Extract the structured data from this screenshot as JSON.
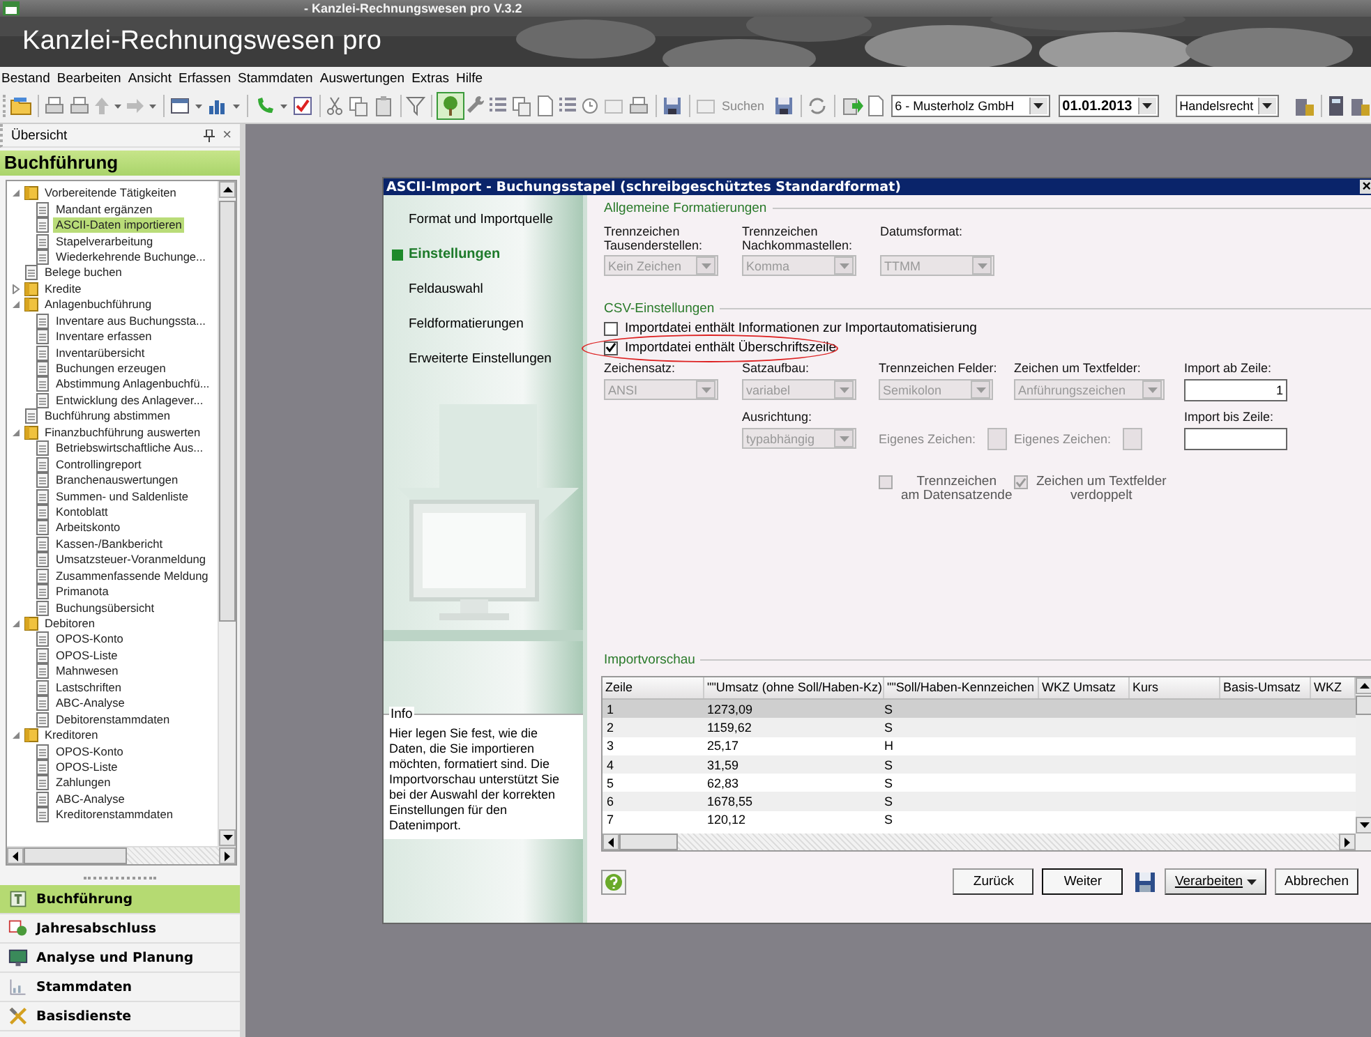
{
  "window": {
    "title": "- Kanzlei-Rechnungswesen pro V.3.2"
  },
  "banner": {
    "title": "Kanzlei-Rechnungswesen pro"
  },
  "menu": [
    "Bestand",
    "Bearbeiten",
    "Ansicht",
    "Erfassen",
    "Stammdaten",
    "Auswertungen",
    "Extras",
    "Hilfe"
  ],
  "toolbar": {
    "search_label": "Suchen",
    "company": "6 - Musterholz GmbH",
    "date": "01.01.2013",
    "law": "Handelsrecht"
  },
  "sidebar": {
    "title": "Übersicht",
    "close": "×",
    "section": "Buchführung",
    "tree": [
      {
        "label": "Vorbereitende Tätigkeiten",
        "kind": "folder",
        "expanded": true,
        "selected": false,
        "children": [
          {
            "label": "Mandant ergänzen",
            "selected": false
          },
          {
            "label": "ASCII-Daten importieren",
            "selected": true
          },
          {
            "label": "Stapelverarbeitung",
            "selected": false
          },
          {
            "label": "Wiederkehrende Buchunge...",
            "selected": false
          }
        ]
      },
      {
        "label": "Belege buchen",
        "kind": "page",
        "selected": false
      },
      {
        "label": "Kredite",
        "kind": "folder",
        "expanded": false,
        "selected": false
      },
      {
        "label": "Anlagenbuchführung",
        "kind": "folder",
        "expanded": true,
        "selected": false,
        "children": [
          {
            "label": "Inventare aus Buchungssta...",
            "selected": false
          },
          {
            "label": "Inventare erfassen",
            "selected": false
          },
          {
            "label": "Inventarübersicht",
            "selected": false
          },
          {
            "label": "Buchungen erzeugen",
            "selected": false
          },
          {
            "label": "Abstimmung Anlagenbuchfü...",
            "selected": false
          },
          {
            "label": "Entwicklung des Anlagever...",
            "selected": false
          }
        ]
      },
      {
        "label": "Buchführung abstimmen",
        "kind": "page",
        "selected": false
      },
      {
        "label": "Finanzbuchführung auswerten",
        "kind": "folder",
        "expanded": true,
        "selected": false,
        "children": [
          {
            "label": "Betriebswirtschaftliche Aus...",
            "selected": false
          },
          {
            "label": "Controllingreport",
            "selected": false
          },
          {
            "label": "Branchenauswertungen",
            "selected": false
          },
          {
            "label": "Summen- und Saldenliste",
            "selected": false
          },
          {
            "label": "Kontoblatt",
            "selected": false
          },
          {
            "label": "Arbeitskonto",
            "selected": false
          },
          {
            "label": "Kassen-/Bankbericht",
            "selected": false
          },
          {
            "label": "Umsatzsteuer-Voranmeldung",
            "selected": false
          },
          {
            "label": "Zusammenfassende Meldung",
            "selected": false
          },
          {
            "label": "Primanota",
            "selected": false
          },
          {
            "label": "Buchungsübersicht",
            "selected": false
          }
        ]
      },
      {
        "label": "Debitoren",
        "kind": "folder",
        "expanded": true,
        "selected": false,
        "children": [
          {
            "label": "OPOS-Konto",
            "selected": false
          },
          {
            "label": "OPOS-Liste",
            "selected": false
          },
          {
            "label": "Mahnwesen",
            "selected": false
          },
          {
            "label": "Lastschriften",
            "selected": false
          },
          {
            "label": "ABC-Analyse",
            "selected": false
          },
          {
            "label": "Debitorenstammdaten",
            "selected": false
          }
        ]
      },
      {
        "label": "Kreditoren",
        "kind": "folder",
        "expanded": true,
        "selected": false,
        "children": [
          {
            "label": "OPOS-Konto",
            "selected": false
          },
          {
            "label": "OPOS-Liste",
            "selected": false
          },
          {
            "label": "Zahlungen",
            "selected": false
          },
          {
            "label": "ABC-Analyse",
            "selected": false
          },
          {
            "label": "Kreditorenstammdaten",
            "selected": false
          }
        ]
      }
    ],
    "nav": [
      {
        "label": "Buchführung",
        "kind": "ledger",
        "selected": true
      },
      {
        "label": "Jahresabschluss",
        "kind": "report",
        "selected": false
      },
      {
        "label": "Analyse und Planung",
        "kind": "monitor",
        "selected": false
      },
      {
        "label": "Stammdaten",
        "kind": "chart",
        "selected": false
      },
      {
        "label": "Basisdienste",
        "kind": "tools",
        "selected": false
      }
    ]
  },
  "dialog": {
    "title": "ASCII-Import - Buchungsstapel (schreibgeschütztes Standardformat)",
    "close": "×",
    "steps": [
      {
        "label": "Format und Importquelle",
        "selected": false
      },
      {
        "label": "Einstellungen",
        "selected": true
      },
      {
        "label": "Feldauswahl",
        "selected": false
      },
      {
        "label": "Feldformatierungen",
        "selected": false
      },
      {
        "label": "Erweiterte Einstellungen",
        "selected": false
      }
    ],
    "info": {
      "title": "Info",
      "text": "Hier legen Sie fest, wie die Daten, die Sie importieren möchten, formatiert sind. Die Importvorschau unterstützt Sie bei der Auswahl der korrekten Einstellungen für den Datenimport."
    },
    "general": {
      "title": "Allgemeine Formatierungen",
      "fields": [
        {
          "label": "Trennzeichen\nTausenderstellen:",
          "value": "Kein Zeichen",
          "disabled": true
        },
        {
          "label": "Trennzeichen\nNachkommastellen:",
          "value": "Komma",
          "disabled": true
        },
        {
          "label": "Datumsformat:",
          "value": "TTMM",
          "disabled": true
        }
      ]
    },
    "csv": {
      "title": "CSV-Einstellungen",
      "checks": [
        {
          "label": "Importdatei enthält Informationen zur Importautomatisierung",
          "checked": false,
          "highlighted": false
        },
        {
          "label": "Importdatei enthält Überschriftszeile",
          "checked": true,
          "highlighted": true
        }
      ],
      "row1": [
        {
          "kind": "combo",
          "label": "Zeichensatz:",
          "value": "ANSI",
          "disabled": true
        },
        {
          "kind": "combo",
          "label": "Satzaufbau:",
          "value": "variabel",
          "disabled": true
        },
        {
          "kind": "combo",
          "label": "Trennzeichen Felder:",
          "value": "Semikolon",
          "disabled": true
        },
        {
          "kind": "combo",
          "label": "Zeichen um Textfelder:",
          "value": "Anführungszeichen",
          "disabled": true
        },
        {
          "kind": "input",
          "label": "Import ab Zeile:",
          "value": "1",
          "disabled": false
        }
      ],
      "row2": [
        {
          "kind": "combo",
          "label": "Ausrichtung:",
          "value": "typabhängig",
          "disabled": true
        },
        {
          "kind": "char",
          "label": "Eigenes Zeichen:",
          "disabled": true
        },
        {
          "kind": "char",
          "label": "Eigenes Zeichen:",
          "disabled": true
        },
        {
          "kind": "input",
          "label": "Import bis Zeile:",
          "disabled": false
        }
      ],
      "row3": [
        {
          "label": "Trennzeichen\nam Datensatzende",
          "checked": false,
          "disabled": true
        },
        {
          "label": "Zeichen um Textfelder\nverdoppelt",
          "checked": true,
          "disabled": true
        }
      ]
    },
    "preview": {
      "title": "Importvorschau",
      "columns": [
        "Zeile",
        "\"\"Umsatz (ohne Soll/Haben-Kz)",
        "\"\"Soll/Haben-Kennzeichen",
        "WKZ Umsatz",
        "Kurs",
        "Basis-Umsatz",
        "WKZ"
      ],
      "rows": [
        {
          "cells": [
            "1",
            "1273,09",
            "S"
          ],
          "selected": true
        },
        {
          "cells": [
            "2",
            "1159,62",
            "S"
          ],
          "selected": false
        },
        {
          "cells": [
            "3",
            "25,17",
            "H"
          ],
          "selected": false
        },
        {
          "cells": [
            "4",
            "31,59",
            "S"
          ],
          "selected": false
        },
        {
          "cells": [
            "5",
            "62,83",
            "S"
          ],
          "selected": false
        },
        {
          "cells": [
            "6",
            "1678,55",
            "S"
          ],
          "selected": false
        },
        {
          "cells": [
            "7",
            "120,12",
            "S"
          ],
          "selected": false
        }
      ]
    },
    "buttons": [
      {
        "label": "Zurück",
        "kind": "push",
        "default": false
      },
      {
        "label": "Weiter",
        "kind": "push",
        "default": true
      },
      {
        "label": "Verarbeiten",
        "kind": "menu",
        "default": false
      },
      {
        "label": "Abbrechen",
        "kind": "push",
        "default": false
      }
    ]
  }
}
